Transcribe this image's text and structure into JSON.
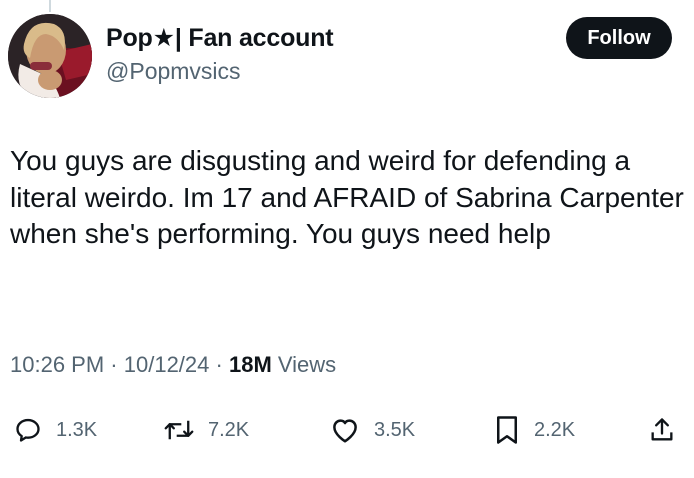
{
  "author": {
    "display_name": "Pop★| Fan account",
    "handle": "@Popmvsics"
  },
  "follow_label": "Follow",
  "tweet": {
    "text": "You guys are disgusting and weird for defending a literal weirdo. Im 17 and AFRAID of Sabrina Carpenter when she's performing. You guys need help"
  },
  "meta": {
    "time": "10:26 PM",
    "separator": "·",
    "date": "10/12/24",
    "views_count": "18M",
    "views_label": "Views"
  },
  "actions": {
    "replies": "1.3K",
    "reposts": "7.2K",
    "likes": "3.5K",
    "bookmarks": "2.2K"
  },
  "icons": {
    "reply": "reply-icon",
    "repost": "repost-icon",
    "like": "heart-icon",
    "bookmark": "bookmark-icon",
    "share": "share-icon"
  },
  "colors": {
    "text_primary": "#0f1419",
    "text_secondary": "#536471",
    "follow_button_bg": "#0f1419",
    "follow_button_text": "#ffffff"
  }
}
